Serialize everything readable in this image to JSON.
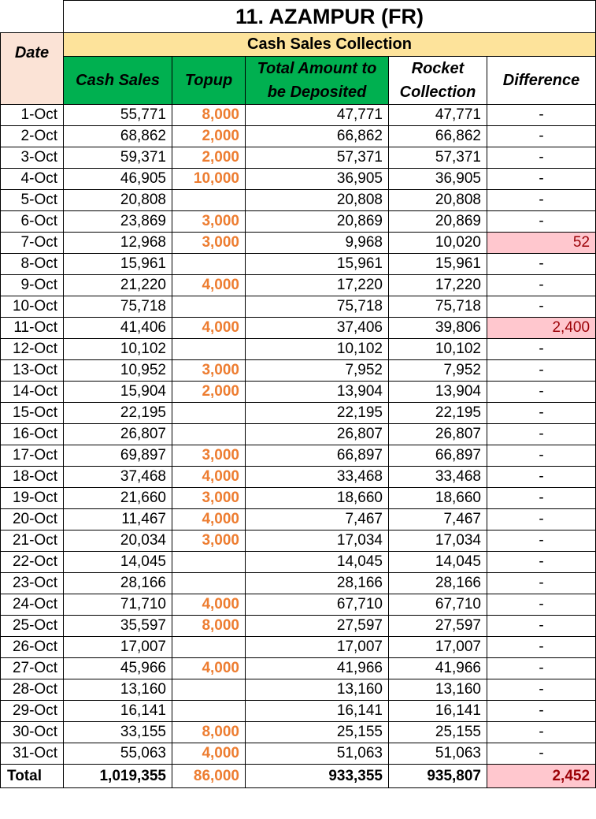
{
  "title": "11. AZAMPUR (FR)",
  "subtitle": "Cash Sales Collection",
  "headers": {
    "date": "Date",
    "cash_sales": "Cash Sales",
    "topup": "Topup",
    "total_amount": "Total Amount to be Deposited",
    "rocket": "Rocket Collection",
    "difference": "Difference"
  },
  "colors": {
    "subtitle_bg": "#fde39b",
    "header_green": "#00b050",
    "date_header_bg": "#fbe3d6",
    "topup_text": "#ed7d31",
    "difference_flag_bg": "#ffc7ce",
    "difference_flag_text": "#9c0006"
  },
  "rows": [
    {
      "date": "1-Oct",
      "cash": "55,771",
      "topup": "8,000",
      "total": "47,771",
      "rocket": "47,771",
      "diff": "-",
      "flag": false
    },
    {
      "date": "2-Oct",
      "cash": "68,862",
      "topup": "2,000",
      "total": "66,862",
      "rocket": "66,862",
      "diff": "-",
      "flag": false
    },
    {
      "date": "3-Oct",
      "cash": "59,371",
      "topup": "2,000",
      "total": "57,371",
      "rocket": "57,371",
      "diff": "-",
      "flag": false
    },
    {
      "date": "4-Oct",
      "cash": "46,905",
      "topup": "10,000",
      "total": "36,905",
      "rocket": "36,905",
      "diff": "-",
      "flag": false
    },
    {
      "date": "5-Oct",
      "cash": "20,808",
      "topup": "",
      "total": "20,808",
      "rocket": "20,808",
      "diff": "-",
      "flag": false
    },
    {
      "date": "6-Oct",
      "cash": "23,869",
      "topup": "3,000",
      "total": "20,869",
      "rocket": "20,869",
      "diff": "-",
      "flag": false
    },
    {
      "date": "7-Oct",
      "cash": "12,968",
      "topup": "3,000",
      "total": "9,968",
      "rocket": "10,020",
      "diff": "52",
      "flag": true
    },
    {
      "date": "8-Oct",
      "cash": "15,961",
      "topup": "",
      "total": "15,961",
      "rocket": "15,961",
      "diff": "-",
      "flag": false
    },
    {
      "date": "9-Oct",
      "cash": "21,220",
      "topup": "4,000",
      "total": "17,220",
      "rocket": "17,220",
      "diff": "-",
      "flag": false
    },
    {
      "date": "10-Oct",
      "cash": "75,718",
      "topup": "",
      "total": "75,718",
      "rocket": "75,718",
      "diff": "-",
      "flag": false
    },
    {
      "date": "11-Oct",
      "cash": "41,406",
      "topup": "4,000",
      "total": "37,406",
      "rocket": "39,806",
      "diff": "2,400",
      "flag": true
    },
    {
      "date": "12-Oct",
      "cash": "10,102",
      "topup": "",
      "total": "10,102",
      "rocket": "10,102",
      "diff": "-",
      "flag": false
    },
    {
      "date": "13-Oct",
      "cash": "10,952",
      "topup": "3,000",
      "total": "7,952",
      "rocket": "7,952",
      "diff": "-",
      "flag": false
    },
    {
      "date": "14-Oct",
      "cash": "15,904",
      "topup": "2,000",
      "total": "13,904",
      "rocket": "13,904",
      "diff": "-",
      "flag": false
    },
    {
      "date": "15-Oct",
      "cash": "22,195",
      "topup": "",
      "total": "22,195",
      "rocket": "22,195",
      "diff": "-",
      "flag": false
    },
    {
      "date": "16-Oct",
      "cash": "26,807",
      "topup": "",
      "total": "26,807",
      "rocket": "26,807",
      "diff": "-",
      "flag": false
    },
    {
      "date": "17-Oct",
      "cash": "69,897",
      "topup": "3,000",
      "total": "66,897",
      "rocket": "66,897",
      "diff": "-",
      "flag": false
    },
    {
      "date": "18-Oct",
      "cash": "37,468",
      "topup": "4,000",
      "total": "33,468",
      "rocket": "33,468",
      "diff": "-",
      "flag": false
    },
    {
      "date": "19-Oct",
      "cash": "21,660",
      "topup": "3,000",
      "total": "18,660",
      "rocket": "18,660",
      "diff": "-",
      "flag": false
    },
    {
      "date": "20-Oct",
      "cash": "11,467",
      "topup": "4,000",
      "total": "7,467",
      "rocket": "7,467",
      "diff": "-",
      "flag": false
    },
    {
      "date": "21-Oct",
      "cash": "20,034",
      "topup": "3,000",
      "total": "17,034",
      "rocket": "17,034",
      "diff": "-",
      "flag": false
    },
    {
      "date": "22-Oct",
      "cash": "14,045",
      "topup": "",
      "total": "14,045",
      "rocket": "14,045",
      "diff": "-",
      "flag": false
    },
    {
      "date": "23-Oct",
      "cash": "28,166",
      "topup": "",
      "total": "28,166",
      "rocket": "28,166",
      "diff": "-",
      "flag": false
    },
    {
      "date": "24-Oct",
      "cash": "71,710",
      "topup": "4,000",
      "total": "67,710",
      "rocket": "67,710",
      "diff": "-",
      "flag": false
    },
    {
      "date": "25-Oct",
      "cash": "35,597",
      "topup": "8,000",
      "total": "27,597",
      "rocket": "27,597",
      "diff": "-",
      "flag": false
    },
    {
      "date": "26-Oct",
      "cash": "17,007",
      "topup": "",
      "total": "17,007",
      "rocket": "17,007",
      "diff": "-",
      "flag": false
    },
    {
      "date": "27-Oct",
      "cash": "45,966",
      "topup": "4,000",
      "total": "41,966",
      "rocket": "41,966",
      "diff": "-",
      "flag": false
    },
    {
      "date": "28-Oct",
      "cash": "13,160",
      "topup": "",
      "total": "13,160",
      "rocket": "13,160",
      "diff": "-",
      "flag": false
    },
    {
      "date": "29-Oct",
      "cash": "16,141",
      "topup": "",
      "total": "16,141",
      "rocket": "16,141",
      "diff": "-",
      "flag": false
    },
    {
      "date": "30-Oct",
      "cash": "33,155",
      "topup": "8,000",
      "total": "25,155",
      "rocket": "25,155",
      "diff": "-",
      "flag": false
    },
    {
      "date": "31-Oct",
      "cash": "55,063",
      "topup": "4,000",
      "total": "51,063",
      "rocket": "51,063",
      "diff": "-",
      "flag": false
    }
  ],
  "totals": {
    "label": "Total",
    "cash": "1,019,355",
    "topup": "86,000",
    "total": "933,355",
    "rocket": "935,807",
    "diff": "2,452",
    "flag": true
  }
}
